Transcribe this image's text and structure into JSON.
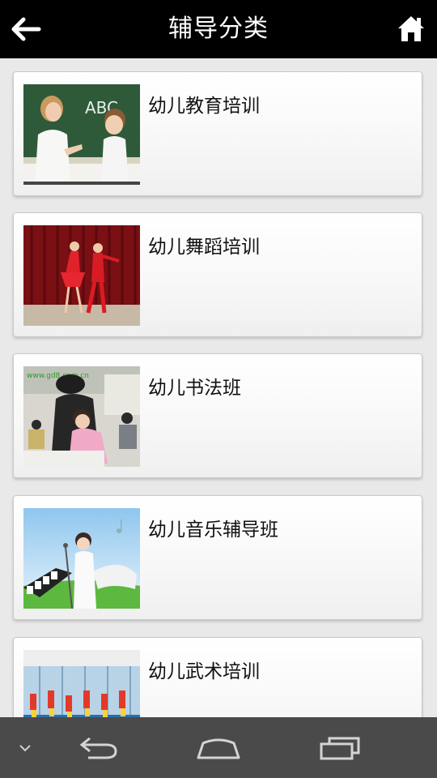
{
  "header": {
    "title": "辅导分类",
    "back_icon": "arrow-left-icon",
    "home_icon": "home-icon"
  },
  "categories": [
    {
      "label": "幼儿教育培训",
      "image": "teacher-child-classroom"
    },
    {
      "label": "幼儿舞蹈培训",
      "image": "children-dancing-stage"
    },
    {
      "label": "幼儿书法班",
      "image": "calligraphy-lesson"
    },
    {
      "label": "幼儿音乐辅导班",
      "image": "girl-singing-piano"
    },
    {
      "label": "幼儿武术培训",
      "image": "martial-arts-class"
    }
  ],
  "thumb_texts": {
    "abc": "ABC",
    "watermark": "www.gd8.com.cn"
  },
  "navbar": {
    "icons": [
      "chevron-down-icon",
      "back-arrow-icon",
      "home-outline-icon",
      "recent-apps-icon"
    ]
  },
  "colors": {
    "header_bg": "#000000",
    "page_bg": "#e9e9e9",
    "navbar_bg": "#4a4a4a"
  }
}
